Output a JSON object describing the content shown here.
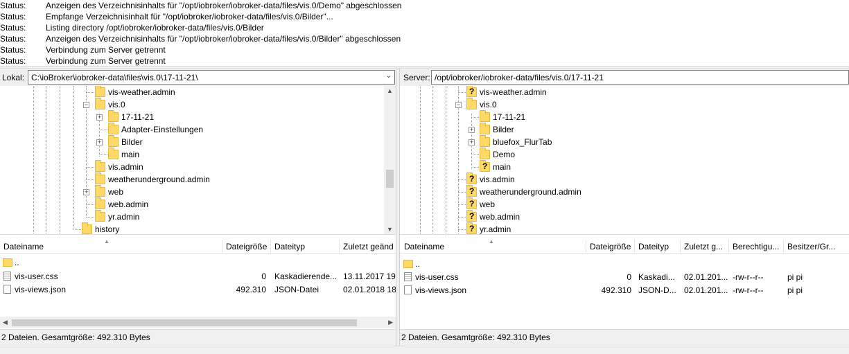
{
  "log": [
    {
      "key": "Status:",
      "msg": "Anzeigen des Verzeichnisinhalts für \"/opt/iobroker/iobroker-data/files/vis.0/Demo\" abgeschlossen"
    },
    {
      "key": "Status:",
      "msg": "Empfange Verzeichnisinhalt für \"/opt/iobroker/iobroker-data/files/vis.0/Bilder\"..."
    },
    {
      "key": "Status:",
      "msg": "Listing directory /opt/iobroker/iobroker-data/files/vis.0/Bilder"
    },
    {
      "key": "Status:",
      "msg": "Anzeigen des Verzeichnisinhalts für \"/opt/iobroker/iobroker-data/files/vis.0/Bilder\" abgeschlossen"
    },
    {
      "key": "Status:",
      "msg": "Verbindung zum Server getrennt"
    },
    {
      "key": "Status:",
      "msg": "Verbindung zum Server getrennt"
    }
  ],
  "local": {
    "label": "Lokal:",
    "path": "C:\\ioBroker\\iobroker-data\\files\\vis.0\\17-11-21\\",
    "tree": [
      {
        "label": "vis-weather.admin",
        "expander": ""
      },
      {
        "label": "vis.0",
        "expander": "−"
      },
      {
        "label": "17-11-21",
        "expander": "+"
      },
      {
        "label": "Adapter-Einstellungen",
        "expander": ""
      },
      {
        "label": "Bilder",
        "expander": "+"
      },
      {
        "label": "main",
        "expander": ""
      },
      {
        "label": "vis.admin",
        "expander": ""
      },
      {
        "label": "weatherunderground.admin",
        "expander": ""
      },
      {
        "label": "web",
        "expander": "+"
      },
      {
        "label": "web.admin",
        "expander": ""
      },
      {
        "label": "yr.admin",
        "expander": ""
      },
      {
        "label": "history",
        "expander": ""
      }
    ],
    "columns": [
      "Dateiname",
      "Dateigröße",
      "Dateityp",
      "Zuletzt geänd"
    ],
    "files": [
      {
        "name": "..",
        "size": "",
        "type": "",
        "modified": ""
      },
      {
        "name": "vis-user.css",
        "size": "0",
        "type": "Kaskadierende...",
        "modified": "13.11.2017 19:"
      },
      {
        "name": "vis-views.json",
        "size": "492.310",
        "type": "JSON-Datei",
        "modified": "02.01.2018 18:"
      }
    ],
    "status": "2 Dateien. Gesamtgröße: 492.310 Bytes"
  },
  "remote": {
    "label": "Server:",
    "path": "/opt/iobroker/iobroker-data/files/vis.0/17-11-21",
    "tree": [
      {
        "label": "vis-weather.admin",
        "expander": ""
      },
      {
        "label": "vis.0",
        "expander": "−"
      },
      {
        "label": "17-11-21",
        "expander": ""
      },
      {
        "label": "Bilder",
        "expander": "+"
      },
      {
        "label": "bluefox_FlurTab",
        "expander": "+"
      },
      {
        "label": "Demo",
        "expander": ""
      },
      {
        "label": "main",
        "expander": ""
      },
      {
        "label": "vis.admin",
        "expander": ""
      },
      {
        "label": "weatherunderground.admin",
        "expander": ""
      },
      {
        "label": "web",
        "expander": ""
      },
      {
        "label": "web.admin",
        "expander": ""
      },
      {
        "label": "yr.admin",
        "expander": ""
      }
    ],
    "columns": [
      "Dateiname",
      "Dateigröße",
      "Dateityp",
      "Zuletzt g...",
      "Berechtigu...",
      "Besitzer/Gr..."
    ],
    "files": [
      {
        "name": "..",
        "size": "",
        "type": "",
        "modified": "",
        "perms": "",
        "owner": ""
      },
      {
        "name": "vis-user.css",
        "size": "0",
        "type": "Kaskadi...",
        "modified": "02.01.201...",
        "perms": "-rw-r--r--",
        "owner": "pi pi"
      },
      {
        "name": "vis-views.json",
        "size": "492.310",
        "type": "JSON-D...",
        "modified": "02.01.201...",
        "perms": "-rw-r--r--",
        "owner": "pi pi"
      }
    ],
    "status": "2 Dateien. Gesamtgröße: 492.310 Bytes"
  }
}
